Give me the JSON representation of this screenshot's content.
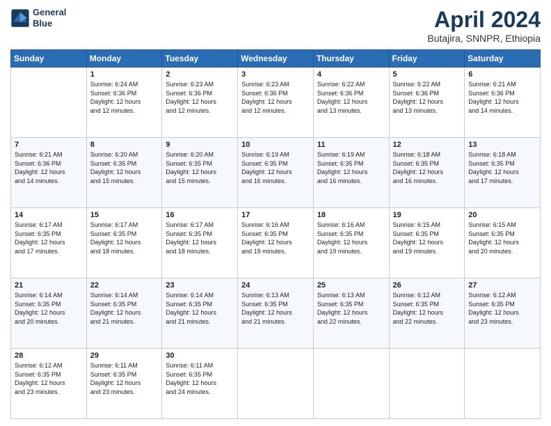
{
  "logo": {
    "line1": "General",
    "line2": "Blue"
  },
  "title": "April 2024",
  "subtitle": "Butajira, SNNPR, Ethiopia",
  "weekdays": [
    "Sunday",
    "Monday",
    "Tuesday",
    "Wednesday",
    "Thursday",
    "Friday",
    "Saturday"
  ],
  "weeks": [
    [
      {
        "num": "",
        "info": ""
      },
      {
        "num": "1",
        "info": "Sunrise: 6:24 AM\nSunset: 6:36 PM\nDaylight: 12 hours\nand 12 minutes."
      },
      {
        "num": "2",
        "info": "Sunrise: 6:23 AM\nSunset: 6:36 PM\nDaylight: 12 hours\nand 12 minutes."
      },
      {
        "num": "3",
        "info": "Sunrise: 6:23 AM\nSunset: 6:36 PM\nDaylight: 12 hours\nand 12 minutes."
      },
      {
        "num": "4",
        "info": "Sunrise: 6:22 AM\nSunset: 6:36 PM\nDaylight: 12 hours\nand 13 minutes."
      },
      {
        "num": "5",
        "info": "Sunrise: 6:22 AM\nSunset: 6:36 PM\nDaylight: 12 hours\nand 13 minutes."
      },
      {
        "num": "6",
        "info": "Sunrise: 6:21 AM\nSunset: 6:36 PM\nDaylight: 12 hours\nand 14 minutes."
      }
    ],
    [
      {
        "num": "7",
        "info": "Sunrise: 6:21 AM\nSunset: 6:36 PM\nDaylight: 12 hours\nand 14 minutes."
      },
      {
        "num": "8",
        "info": "Sunrise: 6:20 AM\nSunset: 6:35 PM\nDaylight: 12 hours\nand 15 minutes."
      },
      {
        "num": "9",
        "info": "Sunrise: 6:20 AM\nSunset: 6:35 PM\nDaylight: 12 hours\nand 15 minutes."
      },
      {
        "num": "10",
        "info": "Sunrise: 6:19 AM\nSunset: 6:35 PM\nDaylight: 12 hours\nand 16 minutes."
      },
      {
        "num": "11",
        "info": "Sunrise: 6:19 AM\nSunset: 6:35 PM\nDaylight: 12 hours\nand 16 minutes."
      },
      {
        "num": "12",
        "info": "Sunrise: 6:18 AM\nSunset: 6:35 PM\nDaylight: 12 hours\nand 16 minutes."
      },
      {
        "num": "13",
        "info": "Sunrise: 6:18 AM\nSunset: 6:35 PM\nDaylight: 12 hours\nand 17 minutes."
      }
    ],
    [
      {
        "num": "14",
        "info": "Sunrise: 6:17 AM\nSunset: 6:35 PM\nDaylight: 12 hours\nand 17 minutes."
      },
      {
        "num": "15",
        "info": "Sunrise: 6:17 AM\nSunset: 6:35 PM\nDaylight: 12 hours\nand 18 minutes."
      },
      {
        "num": "16",
        "info": "Sunrise: 6:17 AM\nSunset: 6:35 PM\nDaylight: 12 hours\nand 18 minutes."
      },
      {
        "num": "17",
        "info": "Sunrise: 6:16 AM\nSunset: 6:35 PM\nDaylight: 12 hours\nand 19 minutes."
      },
      {
        "num": "18",
        "info": "Sunrise: 6:16 AM\nSunset: 6:35 PM\nDaylight: 12 hours\nand 19 minutes."
      },
      {
        "num": "19",
        "info": "Sunrise: 6:15 AM\nSunset: 6:35 PM\nDaylight: 12 hours\nand 19 minutes."
      },
      {
        "num": "20",
        "info": "Sunrise: 6:15 AM\nSunset: 6:35 PM\nDaylight: 12 hours\nand 20 minutes."
      }
    ],
    [
      {
        "num": "21",
        "info": "Sunrise: 6:14 AM\nSunset: 6:35 PM\nDaylight: 12 hours\nand 20 minutes."
      },
      {
        "num": "22",
        "info": "Sunrise: 6:14 AM\nSunset: 6:35 PM\nDaylight: 12 hours\nand 21 minutes."
      },
      {
        "num": "23",
        "info": "Sunrise: 6:14 AM\nSunset: 6:35 PM\nDaylight: 12 hours\nand 21 minutes."
      },
      {
        "num": "24",
        "info": "Sunrise: 6:13 AM\nSunset: 6:35 PM\nDaylight: 12 hours\nand 21 minutes."
      },
      {
        "num": "25",
        "info": "Sunrise: 6:13 AM\nSunset: 6:35 PM\nDaylight: 12 hours\nand 22 minutes."
      },
      {
        "num": "26",
        "info": "Sunrise: 6:12 AM\nSunset: 6:35 PM\nDaylight: 12 hours\nand 22 minutes."
      },
      {
        "num": "27",
        "info": "Sunrise: 6:12 AM\nSunset: 6:35 PM\nDaylight: 12 hours\nand 23 minutes."
      }
    ],
    [
      {
        "num": "28",
        "info": "Sunrise: 6:12 AM\nSunset: 6:35 PM\nDaylight: 12 hours\nand 23 minutes."
      },
      {
        "num": "29",
        "info": "Sunrise: 6:11 AM\nSunset: 6:35 PM\nDaylight: 12 hours\nand 23 minutes."
      },
      {
        "num": "30",
        "info": "Sunrise: 6:11 AM\nSunset: 6:35 PM\nDaylight: 12 hours\nand 24 minutes."
      },
      {
        "num": "",
        "info": ""
      },
      {
        "num": "",
        "info": ""
      },
      {
        "num": "",
        "info": ""
      },
      {
        "num": "",
        "info": ""
      }
    ]
  ]
}
